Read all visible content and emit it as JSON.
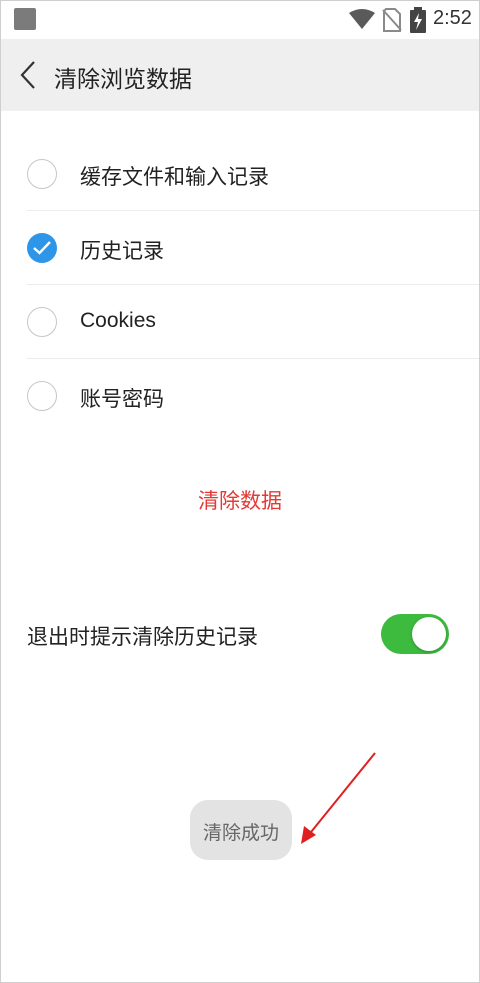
{
  "status_bar": {
    "time": "2:52",
    "icons": [
      "app-notification-icon",
      "wifi-icon",
      "no-sim-icon",
      "battery-charging-icon"
    ]
  },
  "header": {
    "back_icon": "chevron-left-icon",
    "title": "清除浏览数据"
  },
  "options": [
    {
      "label": "缓存文件和输入记录",
      "checked": false
    },
    {
      "label": "历史记录",
      "checked": true
    },
    {
      "label": "Cookies",
      "checked": false
    },
    {
      "label": "账号密码",
      "checked": false
    }
  ],
  "clear_button": {
    "label": "清除数据",
    "color": "#e53935"
  },
  "exit_prompt": {
    "label": "退出时提示清除历史记录",
    "enabled": true,
    "accent": "#3dbb3f"
  },
  "toast": {
    "text": "清除成功"
  },
  "annotation": {
    "type": "arrow",
    "color": "#e02020"
  },
  "colors": {
    "checked_radio": "#2e96e8",
    "header_bg": "#efefef"
  }
}
